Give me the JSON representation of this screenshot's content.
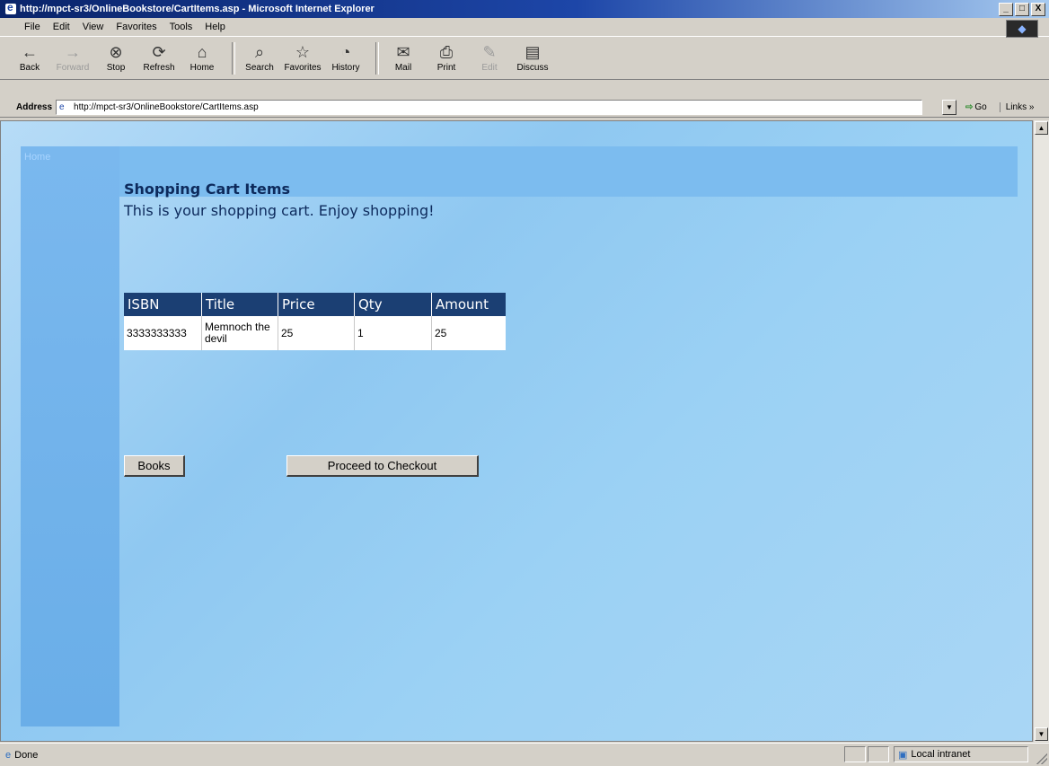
{
  "window": {
    "title": "http://mpct-sr3/OnlineBookstore/CartItems.asp - Microsoft Internet Explorer",
    "controls": [
      "_",
      "□",
      "X"
    ]
  },
  "menu": [
    "File",
    "Edit",
    "View",
    "Favorites",
    "Tools",
    "Help"
  ],
  "toolbar": {
    "back": "Back",
    "forward": "Forward",
    "stop": "Stop",
    "refresh": "Refresh",
    "home": "Home",
    "search": "Search",
    "favorites": "Favorites",
    "history": "History",
    "mail": "Mail",
    "print": "Print",
    "edit": "Edit",
    "discuss": "Discuss"
  },
  "icons": {
    "back": "←",
    "forward": "→",
    "stop": "⊗",
    "refresh": "⟳",
    "home": "⌂",
    "search": "⌕",
    "favorites": "☆",
    "history": "◔",
    "mail": "✉",
    "print": "⎙",
    "edit": "✎",
    "discuss": "▤",
    "go": "⇨",
    "page": "e",
    "zone": "▣",
    "done": "e"
  },
  "address": {
    "label": "Address",
    "url": "http://mpct-sr3/OnlineBookstore/CartItems.asp",
    "go_label": "Go",
    "links_label": "Links »"
  },
  "page": {
    "nav_home": "Home",
    "heading": "Shopping Cart Items",
    "subheading": "This is your shopping cart. Enjoy shopping!",
    "table": {
      "headers": [
        "ISBN",
        "Title",
        "Price",
        "Qty",
        "Amount"
      ],
      "rows": [
        {
          "isbn": "3333333333",
          "title": "Memnoch the devil",
          "price": "25",
          "qty": "1",
          "amount": "25"
        }
      ]
    },
    "buttons": {
      "books": "Books",
      "checkout": "Proceed to Checkout"
    }
  },
  "status": {
    "text": "Done",
    "zone": "Local intranet"
  }
}
